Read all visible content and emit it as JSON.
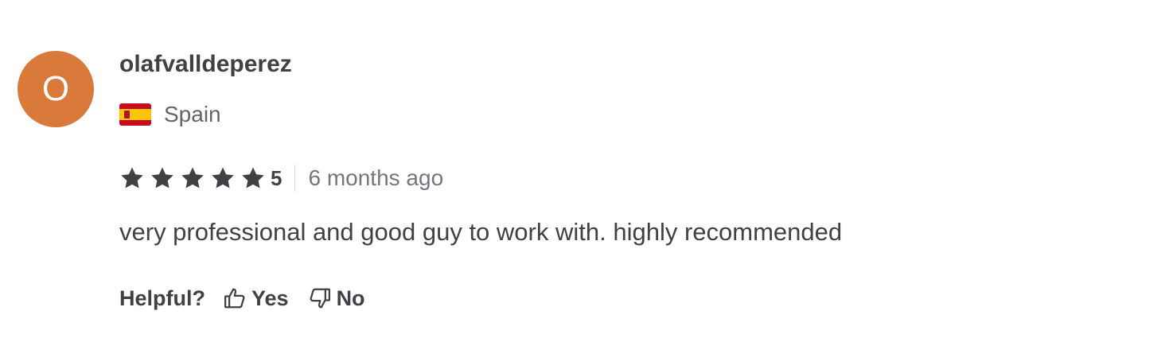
{
  "review": {
    "avatar_initial": "O",
    "avatar_color": "#d9793a",
    "username": "olafvalldeperez",
    "country": "Spain",
    "flag_icon": "spain-flag-icon",
    "rating_stars": 5,
    "rating_value": "5",
    "time": "6 months ago",
    "text": "very professional and good guy to work with. highly recommended"
  },
  "helpful": {
    "label": "Helpful?",
    "yes_label": "Yes",
    "no_label": "No",
    "yes_icon": "thumbs-up-icon",
    "no_icon": "thumbs-down-icon"
  }
}
